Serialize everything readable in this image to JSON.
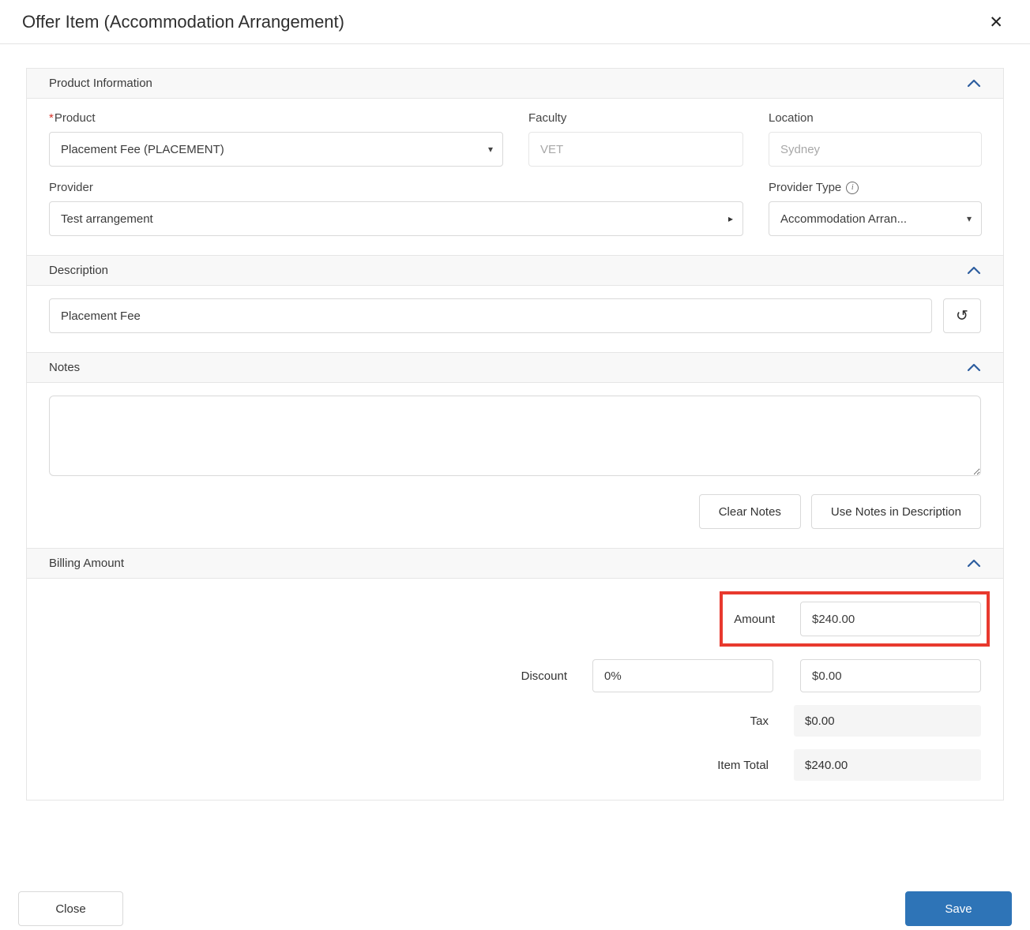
{
  "modal": {
    "title": "Offer Item (Accommodation Arrangement)"
  },
  "icons": {
    "close": "✕",
    "dropdown_caret": "▾",
    "provider_arrow": "▸",
    "info": "i",
    "restore": "↺"
  },
  "product_info": {
    "title": "Product Information",
    "required_marker": "*",
    "product_label": "Product",
    "product_value": "Placement Fee (PLACEMENT)",
    "faculty_label": "Faculty",
    "faculty_value": "VET",
    "location_label": "Location",
    "location_value": "Sydney",
    "provider_label": "Provider",
    "provider_value": "Test arrangement",
    "provider_type_label": "Provider Type",
    "provider_type_value": "Accommodation Arran..."
  },
  "description": {
    "title": "Description",
    "value": "Placement Fee"
  },
  "notes": {
    "title": "Notes",
    "value": "",
    "clear_button": "Clear Notes",
    "use_button": "Use Notes in Description"
  },
  "billing": {
    "title": "Billing Amount",
    "amount_label": "Amount",
    "amount_value": "$240.00",
    "discount_label": "Discount",
    "discount_percent": "0%",
    "discount_value": "$0.00",
    "tax_label": "Tax",
    "tax_value": "$0.00",
    "item_total_label": "Item Total",
    "item_total_value": "$240.00"
  },
  "footer": {
    "close_button": "Close",
    "save_button": "Save"
  },
  "colors": {
    "accent_blue": "#2e74b7",
    "chevron_blue": "#2d5d9f",
    "highlight_red": "#e8392e",
    "section_header_bg": "#f8f8f8",
    "required_red": "#d8342a"
  }
}
